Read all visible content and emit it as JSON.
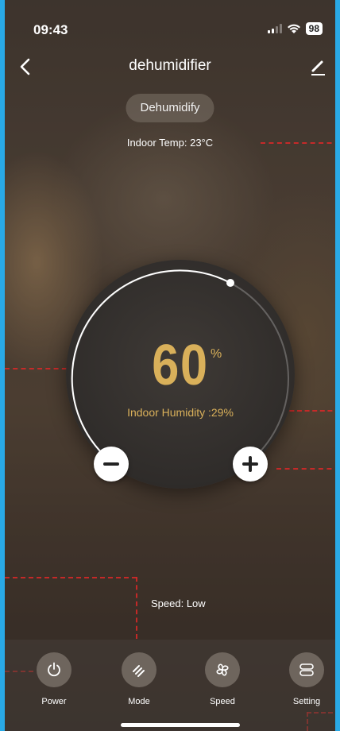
{
  "status_bar": {
    "time": "09:43",
    "battery": "98"
  },
  "header": {
    "title": "dehumidifier"
  },
  "mode": {
    "label": "Dehumidify"
  },
  "indoor_temp": "Indoor Temp: 23°C",
  "dial": {
    "target_value": "60",
    "unit": "%",
    "indoor_humidity": "Indoor Humidity :29%"
  },
  "speed": {
    "label": "Speed: Low"
  },
  "tabs": [
    {
      "label": "Power",
      "icon": "power-icon"
    },
    {
      "label": "Mode",
      "icon": "mode-icon"
    },
    {
      "label": "Speed",
      "icon": "fan-icon"
    },
    {
      "label": "Setting",
      "icon": "setting-icon"
    }
  ],
  "colors": {
    "accent": "#d9b05a",
    "frame_border": "#29a9e6",
    "annotation_dash": "#dc2828"
  }
}
